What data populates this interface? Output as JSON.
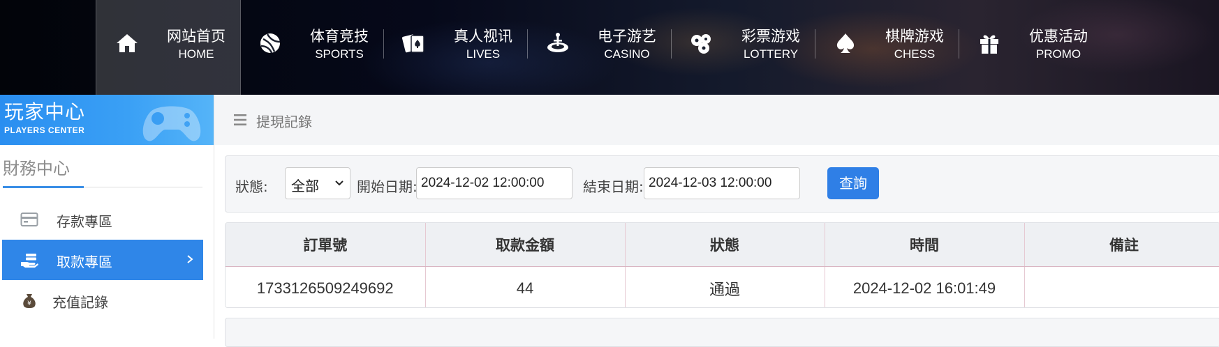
{
  "nav": {
    "items": [
      {
        "cn": "网站首页",
        "en": "HOME",
        "icon": "home-icon"
      },
      {
        "cn": "体育竞技",
        "en": "SPORTS",
        "icon": "ball-icon"
      },
      {
        "cn": "真人视讯",
        "en": "LIVES",
        "icon": "cards-icon"
      },
      {
        "cn": "电子游艺",
        "en": "CASINO",
        "icon": "roulette-icon"
      },
      {
        "cn": "彩票游戏",
        "en": "LOTTERY",
        "icon": "lottery-balls-icon"
      },
      {
        "cn": "棋牌游戏",
        "en": "CHESS",
        "icon": "spade-icon"
      },
      {
        "cn": "优惠活动",
        "en": "PROMO",
        "icon": "gift-icon"
      }
    ],
    "active_index": 0
  },
  "sidebar": {
    "banner_title": "玩家中心",
    "banner_subtitle": "PLAYERS CENTER",
    "section_title": "財務中心",
    "items": [
      {
        "label": "存款專區",
        "icon": "card-icon"
      },
      {
        "label": "取款專區",
        "icon": "hand-money-icon"
      },
      {
        "label": "充值記錄",
        "icon": "money-bag-icon"
      }
    ],
    "active_index": 1
  },
  "main": {
    "breadcrumb": "提現記錄",
    "filter": {
      "status_label": "狀態:",
      "status_value": "全部",
      "start_label": "開始日期:",
      "start_value": "2024-12-02 12:00:00",
      "end_label": "結束日期:",
      "end_value": "2024-12-03 12:00:00",
      "query_label": "查詢"
    },
    "table": {
      "headers": [
        "訂單號",
        "取款金額",
        "狀態",
        "時間",
        "備註"
      ],
      "rows": [
        [
          "1733126509249692",
          "44",
          "通過",
          "2024-12-02 16:01:49",
          ""
        ]
      ]
    }
  },
  "colors": {
    "accent": "#2f86e8",
    "query_button": "#2f7fe6"
  }
}
